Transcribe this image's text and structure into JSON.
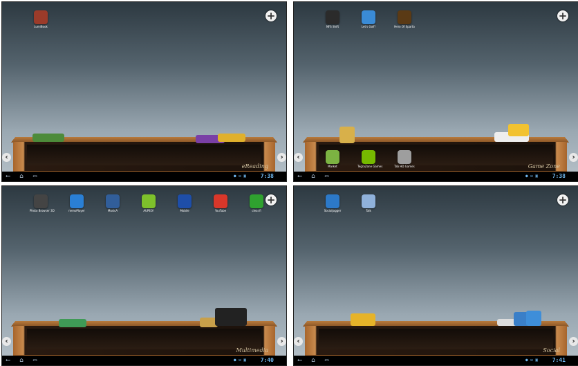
{
  "screens": [
    {
      "apps": [
        {
          "label": "LumiBook",
          "icon": "bookshelf-icon",
          "color": "#9b3b2a"
        }
      ],
      "shelf_apps": [],
      "shelf_name": "eReading",
      "time": "7:38"
    },
    {
      "apps": [
        {
          "label": "NFS Shift",
          "icon": "car-icon",
          "color": "#2b2b2b"
        },
        {
          "label": "Let's Golf!",
          "icon": "golf-icon",
          "color": "#3a8bd6"
        },
        {
          "label": "Hero Of Sparta",
          "icon": "warrior-icon",
          "color": "#5a3a15"
        }
      ],
      "shelf_apps": [
        {
          "label": "Market",
          "icon": "market-bag-icon",
          "color": "#7cb342"
        },
        {
          "label": "TegraZone Games",
          "icon": "nvidia-icon",
          "color": "#76b900"
        },
        {
          "label": "Tab HD Games",
          "icon": "gamepad-icon",
          "color": "#9e9e9e"
        }
      ],
      "shelf_name": "Game Zone",
      "time": "7:38"
    },
    {
      "apps": [
        {
          "label": "Photo Browser 3D",
          "icon": "camera-icon",
          "color": "#444"
        },
        {
          "label": "nemoPlayer",
          "icon": "play-icon",
          "color": "#2a7fd4"
        },
        {
          "label": "MusicA",
          "icon": "music-search-icon",
          "color": "#315e9a"
        },
        {
          "label": "AUPEO!",
          "icon": "aupeo-icon",
          "color": "#7ec12b"
        },
        {
          "label": "Mobile",
          "icon": "music-note-icon",
          "color": "#1e4ea8"
        },
        {
          "label": "YouTube",
          "icon": "youtube-icon",
          "color": "#d9372a"
        },
        {
          "label": "clear.fi",
          "icon": "clearfi-icon",
          "color": "#2fa12f"
        }
      ],
      "shelf_apps": [],
      "shelf_name": "Multimedia",
      "time": "7:40"
    },
    {
      "apps": [
        {
          "label": "Socialjogger",
          "icon": "social-icon",
          "color": "#2c79c8"
        },
        {
          "label": "Talk",
          "icon": "talk-icon",
          "color": "#8fb1da"
        }
      ],
      "shelf_apps": [],
      "shelf_name": "Social",
      "time": "7:41"
    }
  ],
  "plus_label": "+",
  "arrow_left": "‹",
  "arrow_right": "›"
}
